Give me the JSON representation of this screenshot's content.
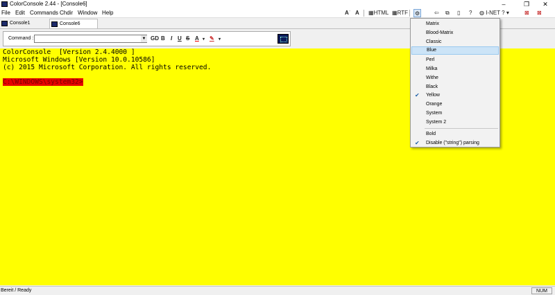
{
  "window": {
    "title": "ColorConsole 2.44  - [Console6]",
    "min": "–",
    "max": "❐",
    "close": "✕"
  },
  "menu": [
    "File",
    "Edit",
    "Commands",
    "Chdir",
    "Window",
    "Help"
  ],
  "toolbar": {
    "html_label": "HTML",
    "rtf_label": "RTF",
    "inet_label": "I-NET ?",
    "help_label": "?"
  },
  "tabs": [
    "Console1",
    "Console6"
  ],
  "command": {
    "label": "Command :",
    "value": "",
    "format_buttons": [
      "GD",
      "B",
      "I",
      "U",
      "S",
      "A",
      "✎"
    ]
  },
  "console": {
    "lines": [
      "ColorConsole  [Version 2.4.4000 ]",
      "Microsoft Windows [Version 10.0.10586]",
      "(c) 2015 Microsoft Corporation. All rights reserved.",
      ""
    ],
    "prompt": "C:\\WINDOWS\\system32>",
    "background": "#ffff00",
    "prompt_color": "#e60000"
  },
  "status": {
    "text": "Bereit / Ready",
    "num": "NUM"
  },
  "color_menu": {
    "items": [
      {
        "label": "Matrix",
        "checked": false,
        "highlighted": false
      },
      {
        "label": "Blood-Matrix",
        "checked": false,
        "highlighted": false
      },
      {
        "label": "Classic",
        "checked": false,
        "highlighted": false
      },
      {
        "label": "Blue",
        "checked": false,
        "highlighted": true
      },
      {
        "label": "Perl",
        "checked": false,
        "highlighted": false
      },
      {
        "label": "Milka",
        "checked": false,
        "highlighted": false
      },
      {
        "label": "Withe",
        "checked": false,
        "highlighted": false
      },
      {
        "label": "Black",
        "checked": false,
        "highlighted": false
      },
      {
        "label": "Yellow",
        "checked": true,
        "highlighted": false
      },
      {
        "label": "Orange",
        "checked": false,
        "highlighted": false
      },
      {
        "label": "System",
        "checked": false,
        "highlighted": false
      },
      {
        "label": "System 2",
        "checked": false,
        "highlighted": false
      }
    ],
    "extra": [
      {
        "label": "Bold",
        "checked": false
      },
      {
        "label": "Disable (\"string\") parsing",
        "checked": true
      }
    ],
    "check_glyph": "✔"
  }
}
